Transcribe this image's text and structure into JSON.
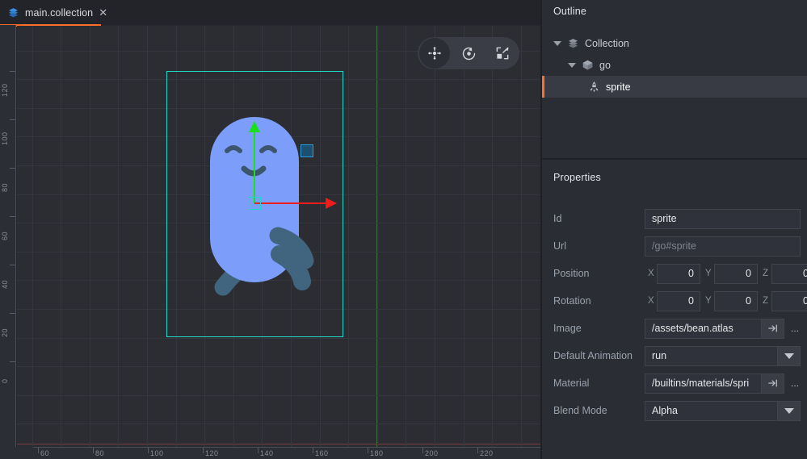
{
  "tab": {
    "label": "main.collection",
    "icon": "collection-icon",
    "close": "✕",
    "accent_color": "#ff6e28"
  },
  "viewport": {
    "toolbar": [
      {
        "name": "move-tool",
        "icon": "move-icon",
        "active": true
      },
      {
        "name": "rotate-tool",
        "icon": "rotate-icon",
        "active": false
      },
      {
        "name": "scale-tool",
        "icon": "scale-icon",
        "active": false
      }
    ],
    "gizmo": {
      "x_axis_color": "#f01b1b",
      "y_axis_color": "#19e019",
      "center_color": "#1fd9c8",
      "xy_handle_color": "#2a9fe0"
    },
    "selection_box_color": "#1fd9c8",
    "sprite_name": "bean",
    "ruler_horizontal": [
      "60",
      "80",
      "100",
      "120",
      "140",
      "160",
      "180",
      "200",
      "220"
    ],
    "ruler_vertical": [
      "120",
      "100",
      "80",
      "60",
      "40",
      "20",
      "0"
    ]
  },
  "outline": {
    "title": "Outline",
    "nodes": [
      {
        "label": "Collection",
        "icon": "collection-icon",
        "depth": 0,
        "expanded": true,
        "selected": false
      },
      {
        "label": "go",
        "icon": "game-object-icon",
        "depth": 1,
        "expanded": true,
        "selected": false
      },
      {
        "label": "sprite",
        "icon": "sprite-icon",
        "depth": 2,
        "expanded": false,
        "selected": true
      }
    ]
  },
  "properties": {
    "title": "Properties",
    "rows": [
      {
        "label": "Id",
        "type": "text",
        "value": "sprite"
      },
      {
        "label": "Url",
        "type": "text",
        "value": "/go#sprite",
        "muted": true
      },
      {
        "label": "Position",
        "type": "vec3",
        "axes": [
          "X",
          "Y",
          "Z"
        ],
        "values": [
          "0",
          "0",
          "0"
        ]
      },
      {
        "label": "Rotation",
        "type": "vec3",
        "axes": [
          "X",
          "Y",
          "Z"
        ],
        "values": [
          "0",
          "0",
          "0"
        ]
      },
      {
        "label": "Image",
        "type": "resource",
        "value": "/assets/bean.atlas",
        "buttons": [
          "goto-resource-icon",
          "..."
        ]
      },
      {
        "label": "Default Animation",
        "type": "dropdown",
        "value": "run"
      },
      {
        "label": "Material",
        "type": "resource",
        "value": "/builtins/materials/spri",
        "buttons": [
          "goto-resource-icon",
          "..."
        ]
      },
      {
        "label": "Blend Mode",
        "type": "dropdown",
        "value": "Alpha"
      }
    ]
  }
}
